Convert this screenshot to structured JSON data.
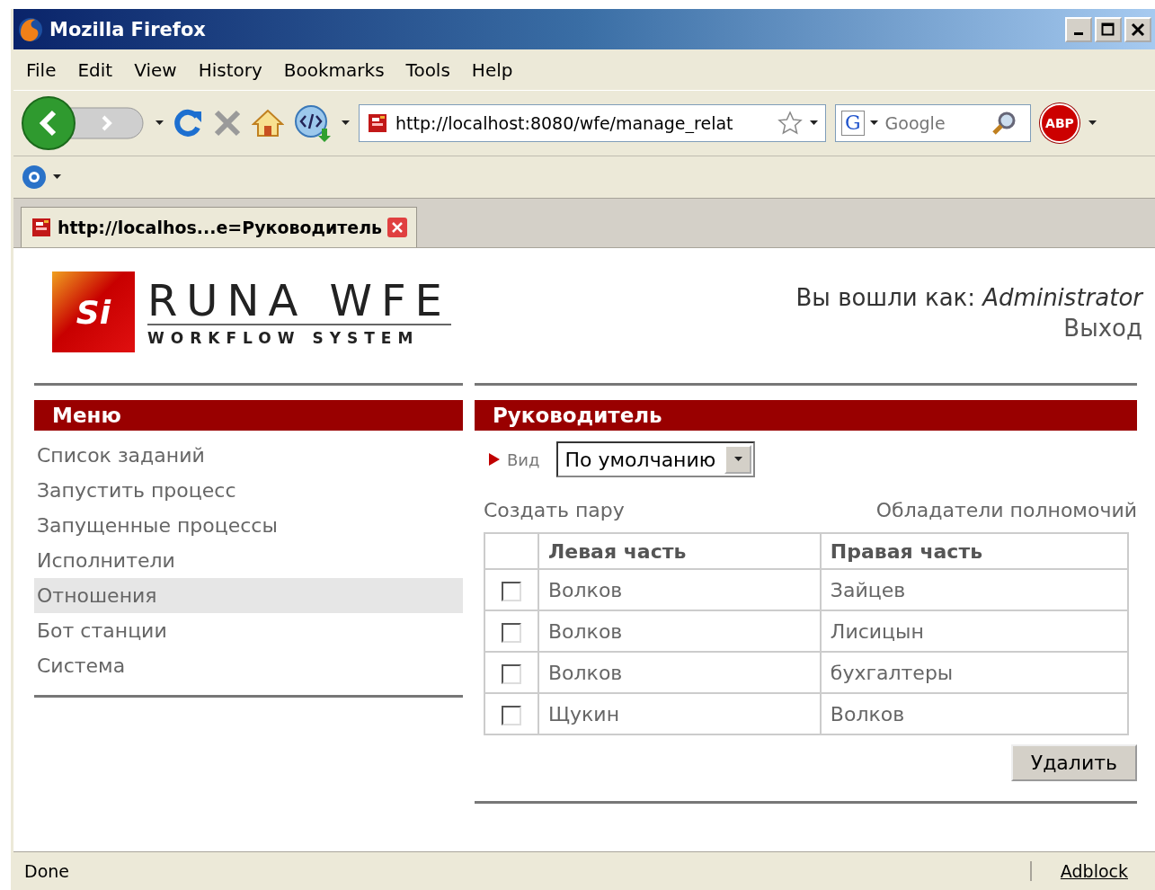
{
  "window": {
    "title": "Mozilla Firefox"
  },
  "menu_bar": [
    "File",
    "Edit",
    "View",
    "History",
    "Bookmarks",
    "Tools",
    "Help"
  ],
  "address_bar": {
    "value": "http://localhost:8080/wfe/manage_relat"
  },
  "search_box": {
    "engine_label": "G",
    "placeholder": "Google"
  },
  "adblock_button": "ABP",
  "tabs": [
    {
      "label": "http://localhos...e=Руководитель",
      "selected": true
    }
  ],
  "page": {
    "logo": {
      "mark": "Si",
      "title": "RUNA WFE",
      "subtitle": "WORKFLOW SYSTEM"
    },
    "login_text": "Вы вошли как: *Administrator*",
    "logout_link": "Выход",
    "menu": {
      "title": "Меню",
      "items": [
        {
          "label": "Список заданий",
          "selected": false
        },
        {
          "label": "Запустить процесс",
          "selected": false
        },
        {
          "label": "Запущенные процессы",
          "selected": false
        },
        {
          "label": "Исполнители",
          "selected": false
        },
        {
          "label": "Отношения",
          "selected": true
        },
        {
          "label": "Бот станции",
          "selected": false
        },
        {
          "label": "Система",
          "selected": false
        }
      ]
    },
    "panel": {
      "title": "Руководитель",
      "view_label": "Вид",
      "view_select": "По умолчанию",
      "create_link": "Создать пару",
      "owners_link": "Обладатели полномочий",
      "table": {
        "columns": [
          "Левая часть",
          "Правая часть"
        ],
        "rows": [
          {
            "checked": false,
            "cells": [
              "Волков",
              "Зайцев"
            ]
          },
          {
            "checked": false,
            "cells": [
              "Волков",
              "Лисицын"
            ]
          },
          {
            "checked": false,
            "cells": [
              "Волков",
              "бухгалтеры"
            ]
          },
          {
            "checked": false,
            "cells": [
              "Щукин",
              "Волков"
            ]
          }
        ]
      },
      "delete_button": "Удалить"
    }
  },
  "status_bar": {
    "text": "Done",
    "adblock": "Adblock"
  }
}
